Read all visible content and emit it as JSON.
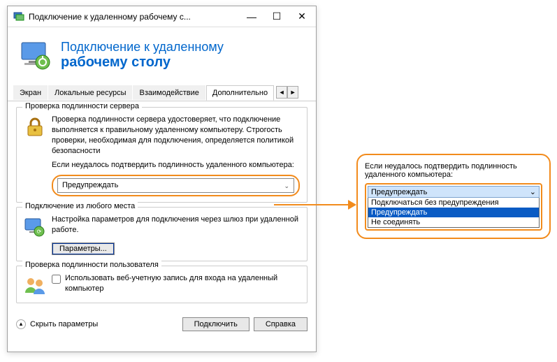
{
  "window": {
    "title": "Подключение к удаленному рабочему с..."
  },
  "header": {
    "line1": "Подключение к удаленному",
    "line2": "рабочему столу"
  },
  "tabs": {
    "items": [
      "Экран",
      "Локальные ресурсы",
      "Взаимодействие",
      "Дополнительно"
    ],
    "active_index": 3
  },
  "group_auth": {
    "title": "Проверка подлинности сервера",
    "desc": "Проверка подлинности сервера удостоверяет, что подключение выполняется к правильному удаленному компьютеру. Строгость проверки, необходимая для подключения, определяется политикой безопасности",
    "prompt": "Если неудалось подтвердить подлинность удаленного компьютера:",
    "selected": "Предупреждать"
  },
  "group_gateway": {
    "title": "Подключение из любого места",
    "desc": "Настройка параметров для подключения через шлюз при удаленной работе.",
    "button": "Параметры..."
  },
  "group_userauth": {
    "title": "Проверка подлинности пользователя",
    "checkbox": "Использовать веб-учетную запись для входа на удаленный компьютер"
  },
  "footer": {
    "hide": "Скрыть параметры",
    "connect": "Подключить",
    "help": "Справка"
  },
  "callout": {
    "prompt": "Если неудалось подтвердить подлинность удаленного компьютера:",
    "selected": "Предупреждать",
    "options": [
      "Подключаться без предупреждения",
      "Предупреждать",
      "Не соединять"
    ],
    "highlight_index": 1
  }
}
